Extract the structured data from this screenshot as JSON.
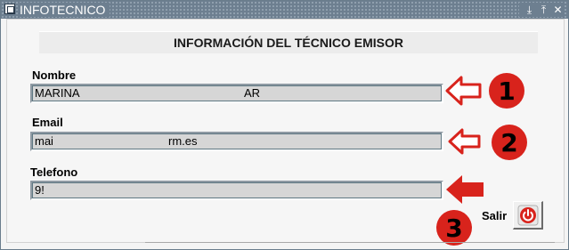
{
  "window": {
    "title": "INFOTECNICO",
    "controls": [
      "⤓",
      "⤒",
      "✕"
    ]
  },
  "header": {
    "title": "INFORMACIÓN DEL TÉCNICO EMISOR"
  },
  "fields": {
    "nombre": {
      "label": "Nombre",
      "value_start": "MARINA",
      "value_end": "AR"
    },
    "email": {
      "label": "Email",
      "value_start": "mai",
      "value_end": "rm.es"
    },
    "telefono": {
      "label": "Telefono",
      "value_start": "9!",
      "value_end": ""
    }
  },
  "annotations": [
    "1",
    "2",
    "3"
  ],
  "exit": {
    "label": "Salir"
  },
  "colors": {
    "annotation_red": "#d8231c",
    "titlebar": "#6d7f90"
  }
}
